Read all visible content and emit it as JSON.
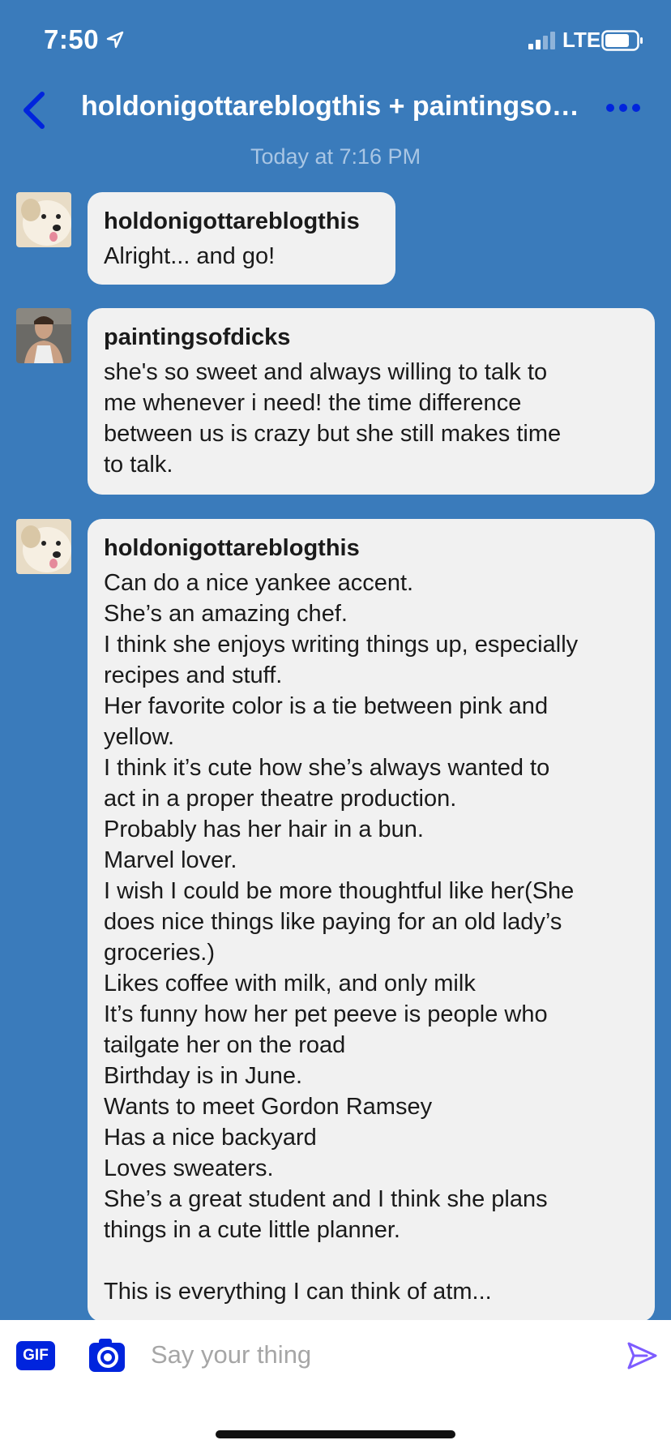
{
  "status_bar": {
    "time": "7:50",
    "network": "LTE"
  },
  "header": {
    "title": "holdonigottareblogthis + paintingsof...",
    "back_icon": "chevron-left-icon",
    "more_icon": "more-dots-icon"
  },
  "timestamp": "Today at 7:16 PM",
  "messages": [
    {
      "sender": "holdonigottareblogthis",
      "avatar": "dog-avatar",
      "text": "Alright... and go!"
    },
    {
      "sender": "paintingsofdicks",
      "avatar": "man-avatar",
      "text": "she's so sweet and always willing to talk to\nme whenever i need! the time difference\nbetween us is crazy but she still makes time\nto talk."
    },
    {
      "sender": "holdonigottareblogthis",
      "avatar": "dog-avatar",
      "text": "Can do a nice yankee accent.\nShe’s an amazing chef.\nI think she enjoys writing things up, especially\nrecipes and stuff.\nHer favorite color is a tie between pink and\nyellow.\nI think it’s cute how she’s always wanted to\nact in a proper theatre production.\nProbably has her hair in a bun.\nMarvel lover.\nI wish I could be more thoughtful like her(She\ndoes nice things like paying for an old lady’s\ngroceries.)\nLikes coffee with milk, and only milk\nIt’s funny how her pet peeve is people who\ntailgate her on the road\nBirthday is in June.\nWants to meet Gordon Ramsey\nHas a nice backyard\nLoves sweaters.\nShe’s a great student and I think she plans\nthings in a cute little planner.\n\nThis is everything I can think of atm..."
    }
  ],
  "composer": {
    "gif_label": "GIF",
    "placeholder": "Say your thing",
    "camera_icon": "camera-icon",
    "send_icon": "send-icon"
  },
  "colors": {
    "background": "#3a7bbb",
    "bubble": "#f1f1f1",
    "accent": "#0024dd"
  }
}
